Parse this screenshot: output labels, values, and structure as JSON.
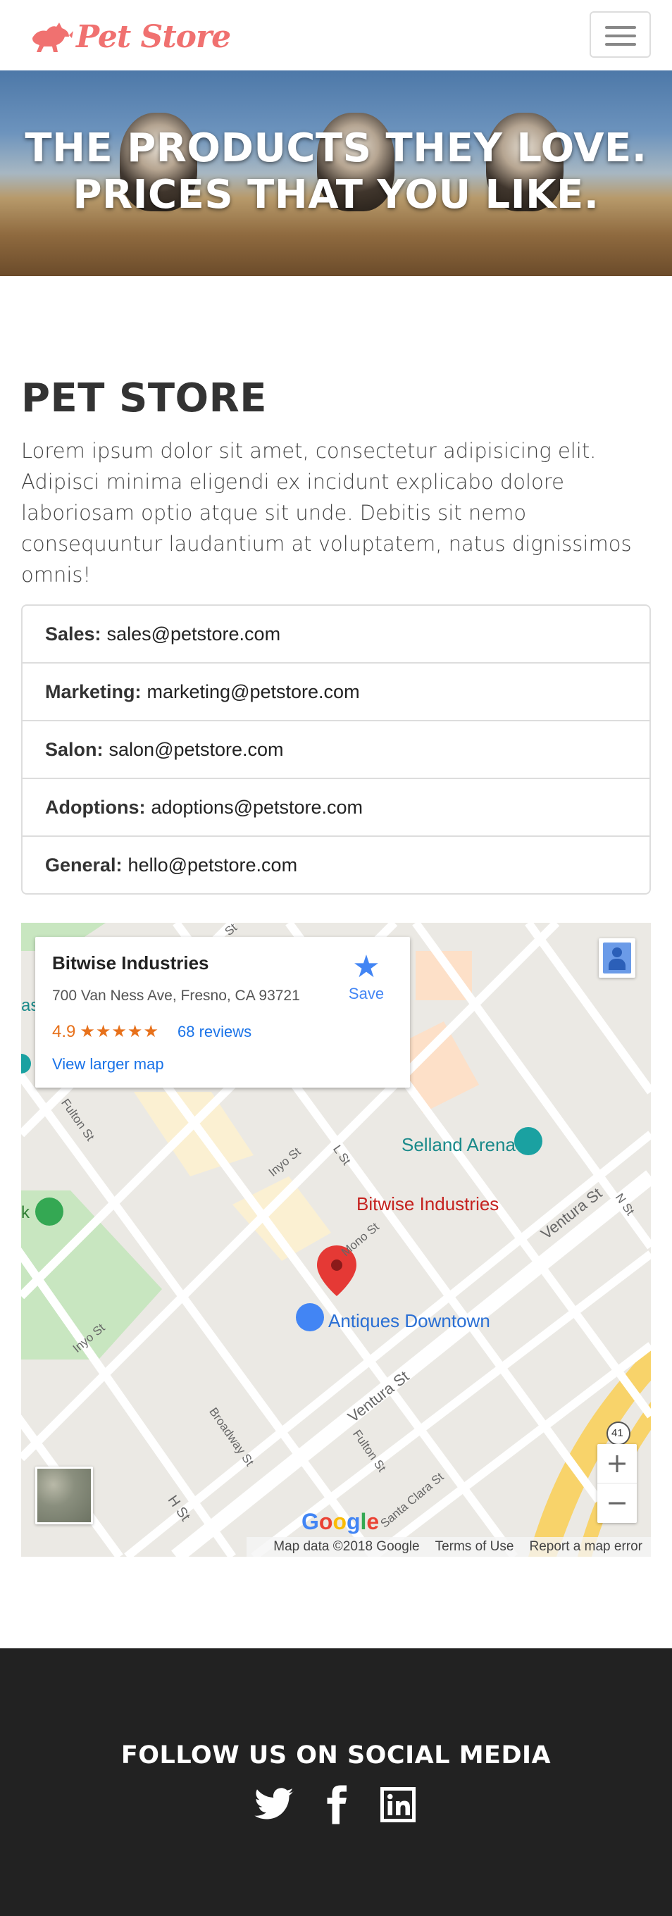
{
  "navbar": {
    "brand": "Pet Store",
    "menu_icon": "hamburger-menu-icon"
  },
  "hero": {
    "title_line1": "THE PRODUCTS THEY LOVE.",
    "title_line2": "PRICES THAT YOU LIKE."
  },
  "about": {
    "title": "PET STORE",
    "text": "Lorem ipsum dolor sit amet, consectetur adipisicing elit. Adipisci minima eligendi ex incidunt explicabo dolore laboriosam optio atque sit unde. Debitis sit nemo consequuntur laudantium at voluptatem, natus dignissimos omnis!"
  },
  "contacts": [
    {
      "label": "Sales:",
      "email": "sales@petstore.com"
    },
    {
      "label": "Marketing:",
      "email": "marketing@petstore.com"
    },
    {
      "label": "Salon:",
      "email": "salon@petstore.com"
    },
    {
      "label": "Adoptions:",
      "email": "adoptions@petstore.com"
    },
    {
      "label": "General:",
      "email": "hello@petstore.com"
    }
  ],
  "map": {
    "card": {
      "name": "Bitwise Industries",
      "address": "700 Van Ness Ave, Fresno, CA 93721",
      "rating": "4.9",
      "stars": "★★★★★",
      "reviews": "68 reviews",
      "larger_map": "View larger map",
      "save": "Save"
    },
    "labels": {
      "selland": "Selland Arena",
      "bitwise": "Bitwise Industries",
      "antiques": "Antiques Downtown",
      "fulton1": "Fulton St",
      "fulton2": "Fulton St",
      "inyo1": "Inyo St",
      "inyo2": "Inyo St",
      "lst": "L St",
      "mono": "Mono St",
      "ventura1": "Ventura St",
      "ventura2": "Ventura St",
      "broadway": "Broadway St",
      "hst": "H St",
      "nst": "N St",
      "santaclara": "Santa Clara St",
      "route": "41",
      "k": "k",
      "as": "as",
      "st": "St"
    },
    "google": "Google",
    "zoom_in": "+",
    "zoom_out": "−",
    "attribution": {
      "data": "Map data ©2018 Google",
      "terms": "Terms of Use",
      "report": "Report a map error"
    },
    "colors": {
      "pin": "#e53935",
      "poi_teal": "#1aa1a1",
      "poi_blue": "#4285f4",
      "highway": "#f8d36a",
      "park": "#c8e6c0"
    }
  },
  "footer": {
    "title": "FOLLOW US ON SOCIAL MEDIA",
    "icons": [
      "twitter-icon",
      "facebook-icon",
      "linkedin-icon"
    ]
  },
  "colors": {
    "brand": "#f07170",
    "footer_bg": "#222222"
  }
}
